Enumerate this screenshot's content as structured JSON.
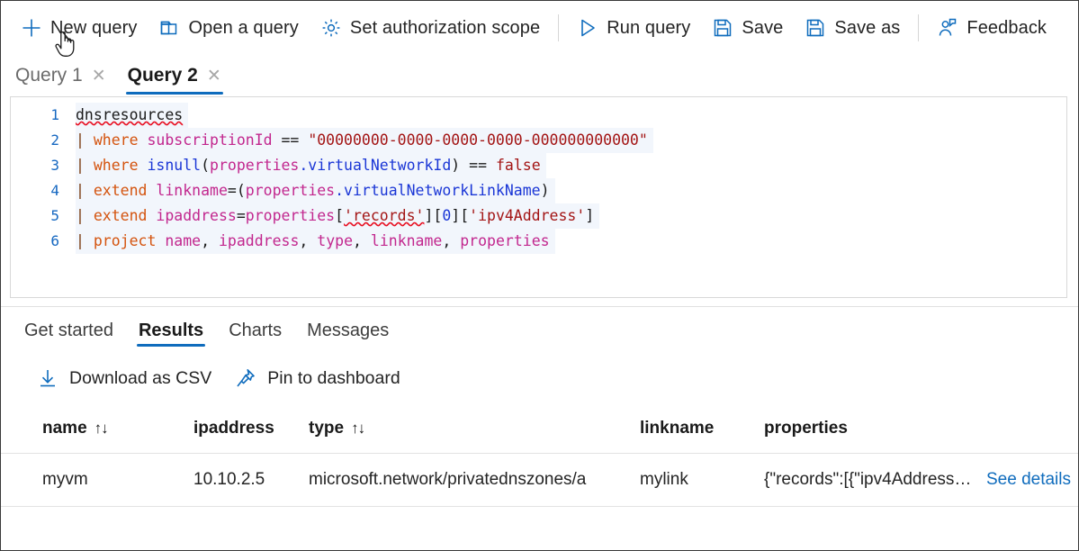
{
  "commandbar": {
    "items": [
      {
        "id": "new-query",
        "label": "New query",
        "icon": "plus-icon"
      },
      {
        "id": "open-query",
        "label": "Open a query",
        "icon": "folder-icon"
      },
      {
        "id": "set-scope",
        "label": "Set authorization scope",
        "icon": "gear-icon"
      },
      {
        "id": "run-query",
        "label": "Run query",
        "icon": "play-icon"
      },
      {
        "id": "save",
        "label": "Save",
        "icon": "save-icon"
      },
      {
        "id": "save-as",
        "label": "Save as",
        "icon": "save-as-icon"
      },
      {
        "id": "feedback",
        "label": "Feedback",
        "icon": "feedback-icon"
      }
    ]
  },
  "query_tabs": {
    "close_glyph": "✕",
    "items": [
      {
        "label": "Query 1",
        "active": false
      },
      {
        "label": "Query 2",
        "active": true
      }
    ]
  },
  "editor": {
    "lines": [
      {
        "number": "1",
        "text": "dnsresources"
      },
      {
        "number": "2",
        "text": "| where subscriptionId == \"00000000-0000-0000-0000-000000000000\""
      },
      {
        "number": "3",
        "text": "| where isnull(properties.virtualNetworkId) == false"
      },
      {
        "number": "4",
        "text": "| extend linkname=(properties.virtualNetworkLinkName)"
      },
      {
        "number": "5",
        "text": "| extend ipaddress=properties['records'][0]['ipv4Address']"
      },
      {
        "number": "6",
        "text": "| project name, ipaddress, type, linkname, properties"
      }
    ],
    "tokens": {
      "line1": {
        "table": "dnsresources"
      },
      "line2": {
        "pipe": "|",
        "kw": "where",
        "col": "subscriptionId",
        "op": "==",
        "str": "\"00000000-0000-0000-0000-000000000000\""
      },
      "line3": {
        "pipe": "|",
        "kw": "where",
        "fn": "isnull",
        "open": "(",
        "col": "properties",
        "prop": ".virtualNetworkId",
        "close": ")",
        "op": "==",
        "bool": "false"
      },
      "line4": {
        "pipe": "|",
        "kw": "extend",
        "col": "linkname",
        "eq": "=(",
        "col2": "properties",
        "prop": ".virtualNetworkLinkName",
        "close": ")"
      },
      "line5": {
        "pipe": "|",
        "kw": "extend",
        "col": "ipaddress",
        "eq": "=",
        "col2": "properties",
        "b1": "[",
        "s1": "'records'",
        "b2": "][",
        "num": "0",
        "b3": "][",
        "s2": "'ipv4Address'",
        "b4": "]"
      },
      "line6": {
        "pipe": "|",
        "kw": "project",
        "c1": "name",
        "c2": "ipaddress",
        "c3": "type",
        "c4": "linkname",
        "c5": "properties",
        "comma": ","
      }
    }
  },
  "results_tabs": {
    "items": [
      {
        "label": "Get started",
        "active": false
      },
      {
        "label": "Results",
        "active": true
      },
      {
        "label": "Charts",
        "active": false
      },
      {
        "label": "Messages",
        "active": false
      }
    ]
  },
  "results_actions": {
    "items": [
      {
        "id": "download-csv",
        "label": "Download as CSV",
        "icon": "download-icon"
      },
      {
        "id": "pin-to-dashboard",
        "label": "Pin to dashboard",
        "icon": "pin-icon"
      }
    ]
  },
  "results_table": {
    "sort_glyph": "↑↓",
    "columns": [
      {
        "label": "name",
        "sortable": true
      },
      {
        "label": "ipaddress",
        "sortable": false
      },
      {
        "label": "type",
        "sortable": true
      },
      {
        "label": "linkname",
        "sortable": false
      },
      {
        "label": "properties",
        "sortable": false
      }
    ],
    "rows": [
      {
        "name": "myvm",
        "ipaddress": "10.10.2.5",
        "type": "microsoft.network/privatednszones/a",
        "linkname": "mylink",
        "properties": "{\"records\":[{\"ipv4Address\":\"10....",
        "details_label": "See details"
      }
    ]
  },
  "colors": {
    "accent": "#0f6cbd",
    "link": "#0f6cbd",
    "text": "#242424",
    "muted": "#6b6b6b",
    "border": "#e3e3e3",
    "editor_highlight": "#f2f6fc",
    "squiggle": "#e81123",
    "kw_orange": "#d4540f",
    "col_magenta": "#c2278e",
    "str_red": "#a31515",
    "fn_blue": "#1a36d6",
    "gutter_blue": "#1668c1"
  }
}
